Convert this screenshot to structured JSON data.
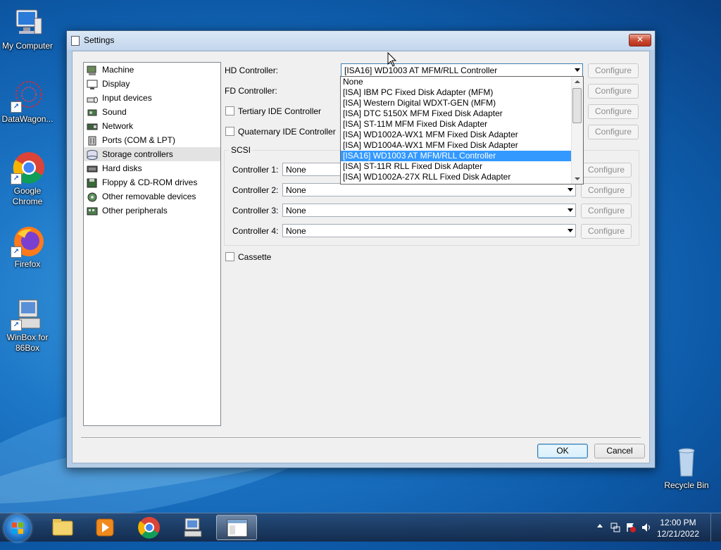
{
  "desktop": {
    "icons": [
      {
        "label": "My Computer"
      },
      {
        "label": "DataWagon..."
      },
      {
        "label": "Google Chrome"
      },
      {
        "label": "Firefox"
      },
      {
        "label": "WinBox for 86Box"
      },
      {
        "label": "Recycle Bin"
      }
    ]
  },
  "dialog": {
    "title": "Settings",
    "close_label": "✕",
    "nav": [
      {
        "label": "Machine"
      },
      {
        "label": "Display"
      },
      {
        "label": "Input devices"
      },
      {
        "label": "Sound"
      },
      {
        "label": "Network"
      },
      {
        "label": "Ports (COM & LPT)"
      },
      {
        "label": "Storage controllers"
      },
      {
        "label": "Hard disks"
      },
      {
        "label": "Floppy & CD-ROM drives"
      },
      {
        "label": "Other removable devices"
      },
      {
        "label": "Other peripherals"
      }
    ],
    "selected_nav": "Storage controllers",
    "hd_controller": {
      "label": "HD Controller:",
      "value": "[ISA16] WD1003 AT MFM/RLL Controller"
    },
    "fd_controller": {
      "label": "FD Controller:"
    },
    "tertiary_ide": {
      "label": "Tertiary IDE Controller",
      "checked": false
    },
    "quaternary_ide": {
      "label": "Quaternary IDE Controller",
      "checked": false
    },
    "configure_label": "Configure",
    "scsi": {
      "title": "SCSI",
      "controllers": [
        {
          "label": "Controller 1:",
          "value": "None"
        },
        {
          "label": "Controller 2:",
          "value": "None"
        },
        {
          "label": "Controller 3:",
          "value": "None"
        },
        {
          "label": "Controller 4:",
          "value": "None"
        }
      ]
    },
    "cassette": {
      "label": "Cassette",
      "checked": false
    },
    "ok_label": "OK",
    "cancel_label": "Cancel",
    "dropdown_options": [
      "None",
      "[ISA] IBM PC Fixed Disk Adapter (MFM)",
      "[ISA] Western Digital WDXT-GEN (MFM)",
      "[ISA] DTC 5150X MFM Fixed Disk Adapter",
      "[ISA] ST-11M MFM Fixed Disk Adapter",
      "[ISA] WD1002A-WX1 MFM Fixed Disk Adapter",
      "[ISA] WD1004A-WX1 MFM Fixed Disk Adapter",
      "[ISA16] WD1003 AT MFM/RLL Controller",
      "[ISA] ST-11R RLL Fixed Disk Adapter",
      "[ISA] WD1002A-27X RLL Fixed Disk Adapter"
    ],
    "dropdown_selected_index": 7
  },
  "taskbar": {
    "time": "12:00 PM",
    "date": "12/21/2022"
  },
  "colors": {
    "selection": "#3399ff",
    "nav_selected": "#e3e3e3"
  }
}
